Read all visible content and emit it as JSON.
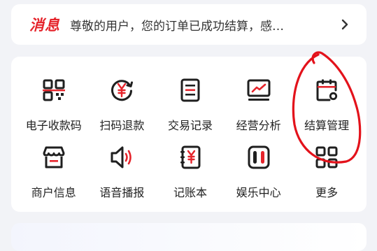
{
  "notice": {
    "tag": "消息",
    "text": "尊敬的用户，您的订单已成功结算，感…"
  },
  "menu": {
    "items": [
      {
        "label": "电子收款码",
        "icon": "qr-code-icon"
      },
      {
        "label": "扫码退款",
        "icon": "yen-refund-icon"
      },
      {
        "label": "交易记录",
        "icon": "document-list-icon"
      },
      {
        "label": "经营分析",
        "icon": "chart-monitor-icon"
      },
      {
        "label": "结算管理",
        "icon": "calendar-settings-icon"
      },
      {
        "label": "商户信息",
        "icon": "store-icon"
      },
      {
        "label": "语音播报",
        "icon": "speaker-icon"
      },
      {
        "label": "记账本",
        "icon": "ledger-icon"
      },
      {
        "label": "娱乐中心",
        "icon": "game-controller-icon"
      },
      {
        "label": "更多",
        "icon": "grid-more-icon"
      }
    ]
  },
  "colors": {
    "icon_dark": "#1f1f1f",
    "accent_red": "#e5242b",
    "annotation_red": "#e3121b"
  }
}
